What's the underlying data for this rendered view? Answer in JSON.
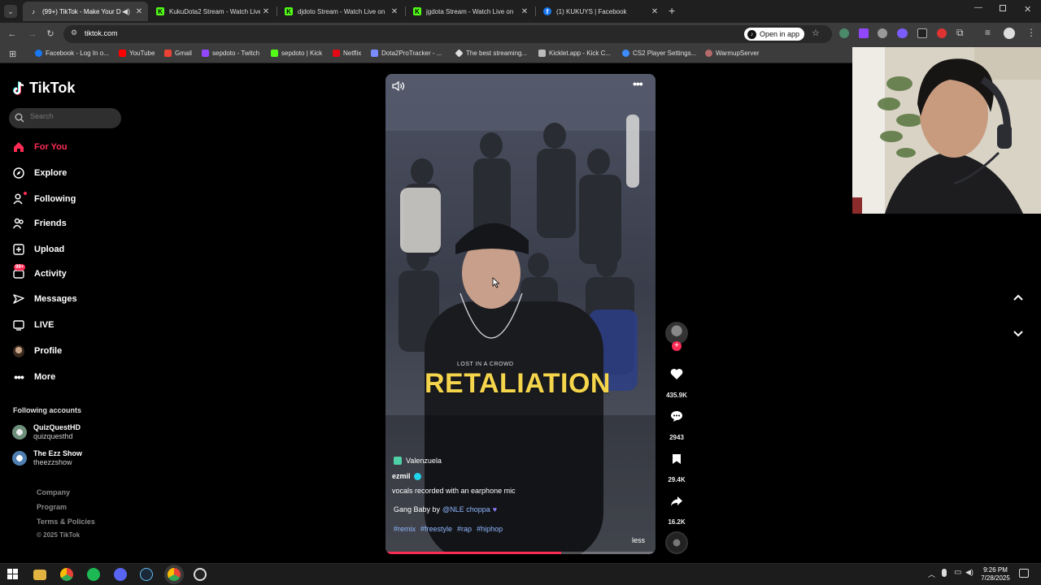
{
  "browser": {
    "tabs": [
      {
        "label": "(99+) TikTok - Make Your D",
        "icon": "tiktok-icon",
        "active": true
      },
      {
        "label": "KukuDota2 Stream - Watch Live",
        "icon": "kick-icon",
        "active": false
      },
      {
        "label": "djdoto Stream - Watch Live on",
        "icon": "kick-icon",
        "active": false
      },
      {
        "label": "jgdota Stream - Watch Live on",
        "icon": "kick-icon",
        "active": false
      },
      {
        "label": "(1) KUKUYS | Facebook",
        "icon": "facebook-icon",
        "active": false
      }
    ],
    "url": "tiktok.com",
    "open_in_app_label": "Open in app",
    "bookmarks": [
      {
        "label": "Facebook - Log In o...",
        "color": "#1877f2"
      },
      {
        "label": "YouTube",
        "color": "#ff0000"
      },
      {
        "label": "Gmail",
        "color": "#ea4335"
      },
      {
        "label": "sepdoto - Twitch",
        "color": "#9146ff"
      },
      {
        "label": "sepdoto | Kick",
        "color": "#53fc18"
      },
      {
        "label": "Netflix",
        "color": "#e50914"
      },
      {
        "label": "Dota2ProTracker - ...",
        "color": "#7b8cff"
      },
      {
        "label": "The best streaming...",
        "color": "#dddddd"
      },
      {
        "label": "Kicklet.app - Kick C...",
        "color": "#bbbbbb"
      },
      {
        "label": "CS2 Player Settings...",
        "color": "#3f8cff"
      },
      {
        "label": "WarmupServer",
        "color": "#b46a6a"
      }
    ]
  },
  "sidebar": {
    "logo": "TikTok",
    "search_placeholder": "Search",
    "items": [
      {
        "label": "For You",
        "icon": "home-icon",
        "active": true
      },
      {
        "label": "Explore",
        "icon": "compass-icon"
      },
      {
        "label": "Following",
        "icon": "following-icon"
      },
      {
        "label": "Friends",
        "icon": "friends-icon"
      },
      {
        "label": "Upload",
        "icon": "upload-icon"
      },
      {
        "label": "Activity",
        "icon": "activity-icon",
        "badge": "99+"
      },
      {
        "label": "Messages",
        "icon": "messages-icon"
      },
      {
        "label": "LIVE",
        "icon": "live-icon"
      },
      {
        "label": "Profile",
        "icon": "profile-avatar"
      },
      {
        "label": "More",
        "icon": "more-icon"
      }
    ],
    "following_accounts_heading": "Following accounts",
    "accounts": [
      {
        "name": "QuizQuestHD",
        "username": "quizquesthd"
      },
      {
        "name": "The Ezz Show",
        "username": "theezzshow"
      }
    ],
    "footer": [
      "Company",
      "Program",
      "Terms & Policies"
    ],
    "copyright": "© 2025 TikTok"
  },
  "video": {
    "overlay_text": "RETALIATION",
    "small_text": "LOST IN A CROWD",
    "location": "Valenzuela",
    "author": "ezmil",
    "caption": "vocals recorded with an earphone mic",
    "music_prefix": "Gang Baby by",
    "music_artist": "@NLE choppa",
    "hashtags": [
      "#remix",
      "#freestyle",
      "#rap",
      "#hiphop"
    ],
    "less_label": "less",
    "progress": 0.65
  },
  "actions": {
    "likes": "435.9K",
    "comments": "2943",
    "saves": "29.4K",
    "shares": "16.2K"
  },
  "taskbar": {
    "time": "9:26 PM",
    "date": "7/28/2025"
  },
  "colors": {
    "tiktok_red": "#fe2c55",
    "hashtag_blue": "#8fb6ff",
    "overlay_yellow": "#f5d54b"
  }
}
